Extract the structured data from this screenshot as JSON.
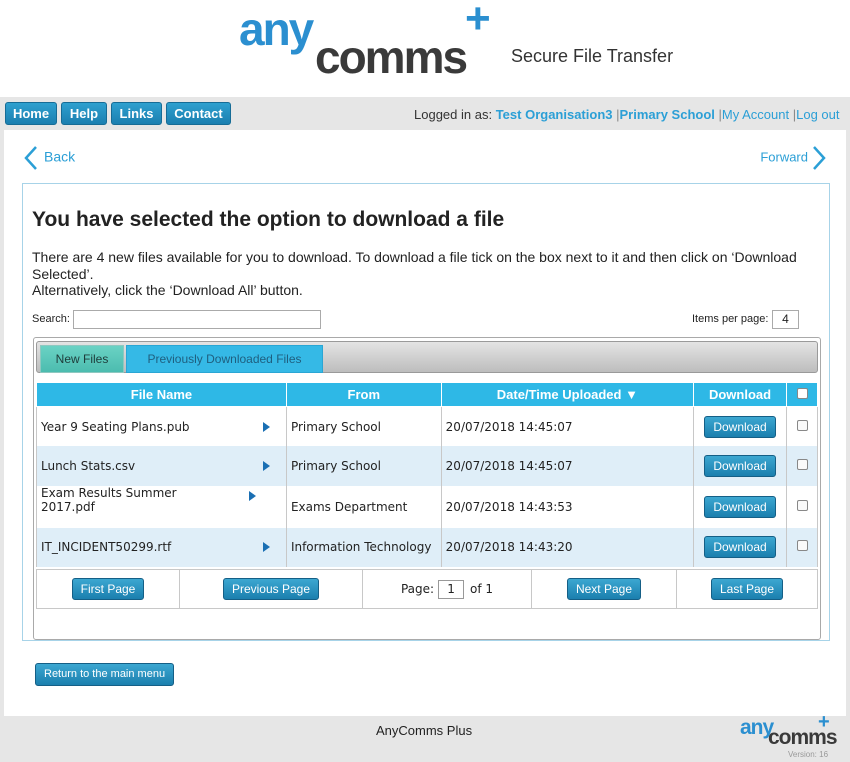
{
  "brand": {
    "logo_any": "any",
    "logo_comms": "comms",
    "logo_plus": "+",
    "tagline": "Secure File Transfer",
    "accent_color": "#2b9fd6"
  },
  "nav": {
    "items": [
      {
        "label": "Home"
      },
      {
        "label": "Help"
      },
      {
        "label": "Links"
      },
      {
        "label": "Contact"
      }
    ]
  },
  "login": {
    "prefix": "Logged in as:",
    "organisation": "Test Organisation3",
    "school": "Primary School",
    "my_account": "My Account",
    "log_out": "Log out",
    "separator": "|"
  },
  "navigation": {
    "back": "Back",
    "forward": "Forward"
  },
  "page": {
    "heading": "You have selected the option to download a file",
    "intro_line1": "There are 4 new files available for you to download. To download a file tick on the box next to it and then click on ‘Download Selected’.",
    "intro_line2": "Alternatively, click the ‘Download All’ button."
  },
  "search": {
    "label": "Search:",
    "value": ""
  },
  "items_per_page": {
    "label": "Items per page:",
    "value": "4"
  },
  "tabs": [
    {
      "label": "New Files",
      "active": true
    },
    {
      "label": "Previously Downloaded Files",
      "active": false
    }
  ],
  "table": {
    "headers": [
      "File Name",
      "From",
      "Date/Time Uploaded ▼",
      "Download"
    ],
    "rows": [
      {
        "file": "Year 9 Seating Plans.pub",
        "from": "Primary School",
        "uploaded": "20/07/2018 14:45:07",
        "action": "Download"
      },
      {
        "file": "Lunch Stats.csv",
        "from": "Primary School",
        "uploaded": "20/07/2018 14:45:07",
        "action": "Download"
      },
      {
        "file": "Exam Results Summer 2017.pdf",
        "from": "Exams Department",
        "uploaded": "20/07/2018 14:43:53",
        "action": "Download"
      },
      {
        "file": "IT_INCIDENT50299.rtf",
        "from": "Information Technology",
        "uploaded": "20/07/2018 14:43:20",
        "action": "Download"
      }
    ]
  },
  "pager": {
    "first": "First Page",
    "previous": "Previous Page",
    "page_label": "Page:",
    "page_value": "1",
    "of_label": "of 1",
    "next": "Next Page",
    "last": "Last Page"
  },
  "return_button": "Return to the main menu",
  "footer": {
    "text": "AnyComms Plus",
    "version": "Version: 16"
  }
}
